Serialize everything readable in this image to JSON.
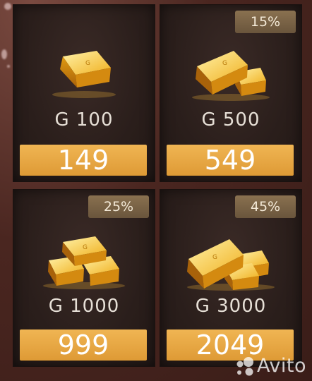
{
  "items": [
    {
      "gold_label": "G 100",
      "price": "149",
      "discount": ""
    },
    {
      "gold_label": "G 500",
      "price": "549",
      "discount": "15%"
    },
    {
      "gold_label": "G 1000",
      "price": "999",
      "discount": "25%"
    },
    {
      "gold_label": "G 3000",
      "price": "2049",
      "discount": "45%"
    }
  ],
  "watermark": {
    "text": "Avito",
    "icon": "avito-logo-icon"
  },
  "colors": {
    "price_button": "#e8a844",
    "badge": "#7a6246",
    "card": "#2a1e1b",
    "background": "#4a2620",
    "gold": "#f4b52a"
  }
}
